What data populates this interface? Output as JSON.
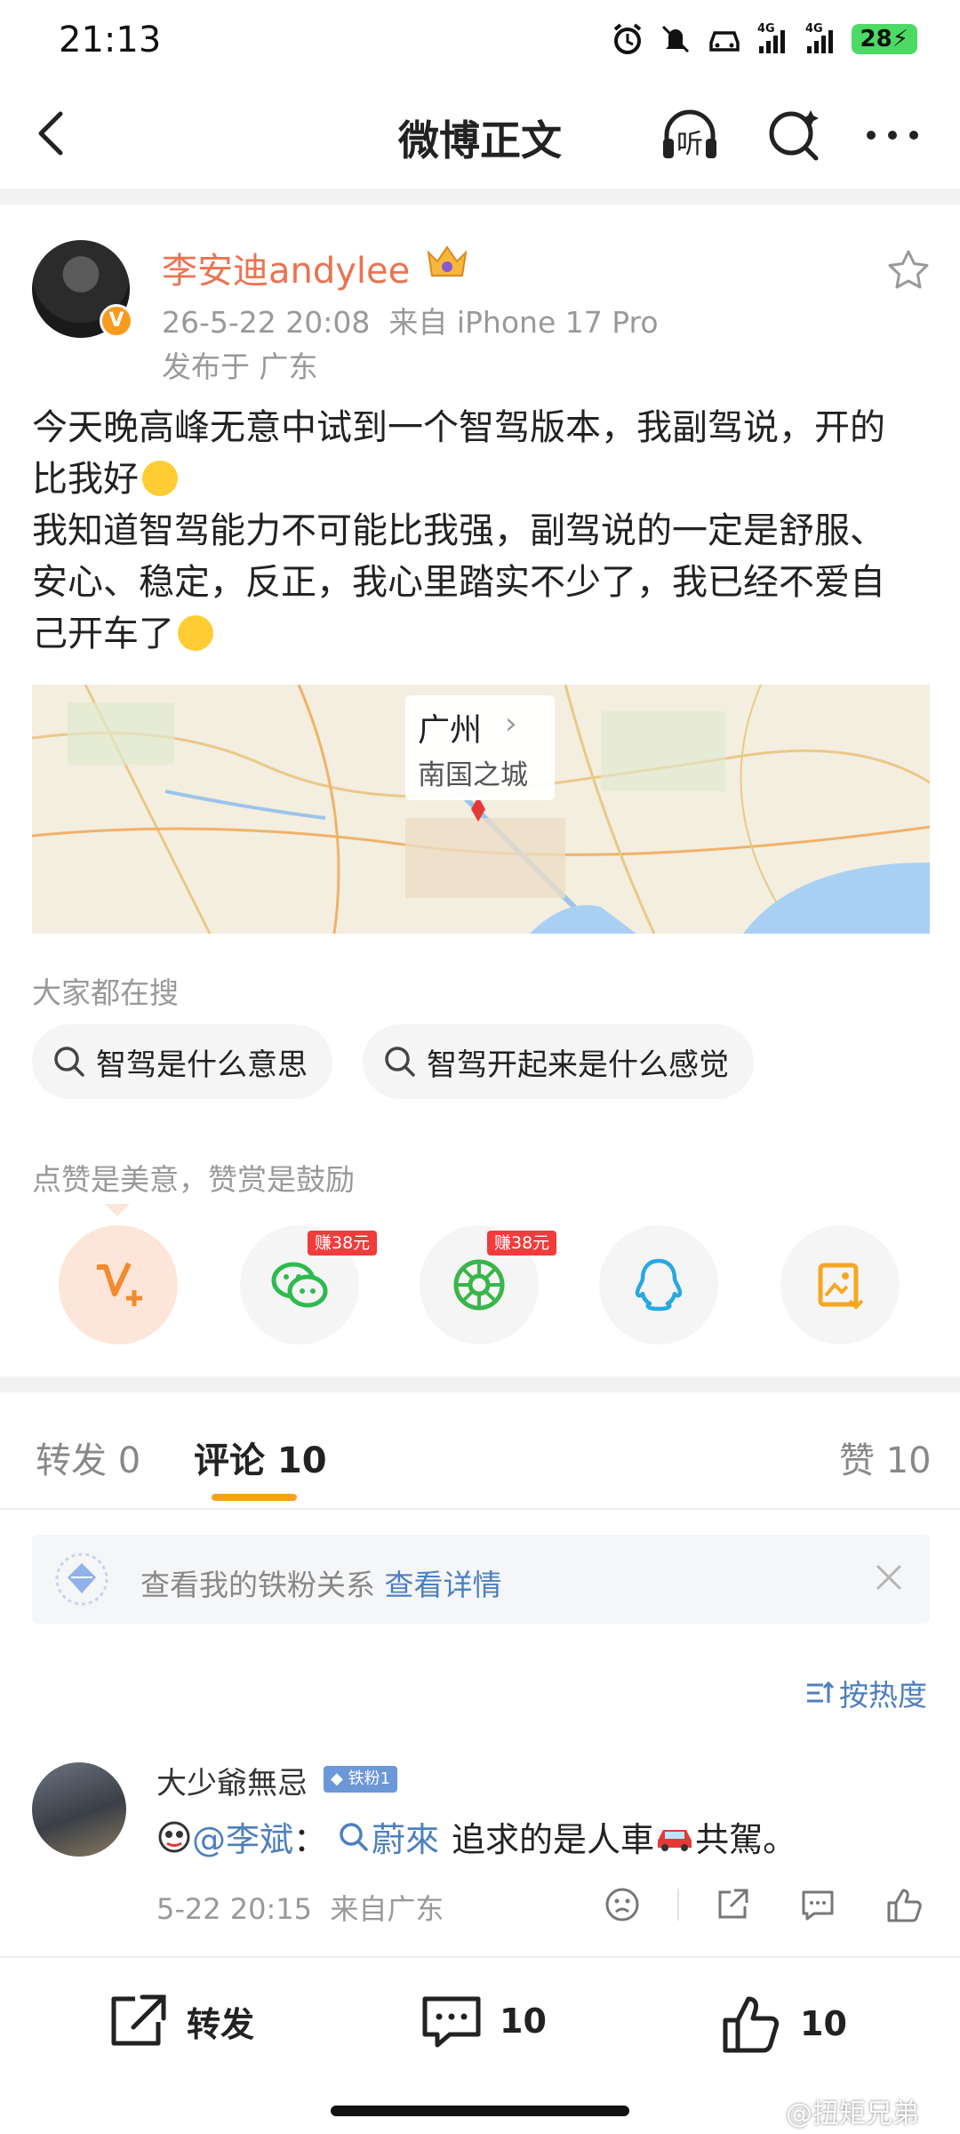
{
  "status_bar": {
    "time": "21:13",
    "network_1": "4G",
    "network_2": "4G",
    "battery": "28"
  },
  "header": {
    "title": "微博正文",
    "listen_label": "听"
  },
  "post": {
    "author": "李安迪andylee",
    "timestamp": "26-5-22 20:08",
    "source": "来自 iPhone 17 Pro",
    "location": "发布于 广东",
    "text_lines": [
      "今天晚高峰无意中试到一个智驾版本，我副驾说，开的",
      "比我好",
      "我知道智驾能力不可能比我强，副驾说的一定是舒服、",
      "安心、稳定，反正，我心里踏实不少了，我已经不爱自",
      "己开车了"
    ]
  },
  "map": {
    "city": "广州",
    "subtitle": "南国之城"
  },
  "searches": {
    "label": "大家都在搜",
    "items": [
      "智驾是什么意思",
      "智驾开起来是什么感觉"
    ]
  },
  "reward": {
    "label": "点赞是美意，赞赏是鼓励",
    "badge_text": "赚38元"
  },
  "tabs": {
    "repost": "转发 0",
    "comments": "评论 10",
    "likes": "赞 10"
  },
  "fan_banner": {
    "text": "查看我的铁粉关系",
    "link": "查看详情"
  },
  "sort": {
    "label": "按热度"
  },
  "comment": {
    "username": "大少爺無忌",
    "fan_tag": "铁粉1",
    "mention": "@李斌",
    "colon": "：",
    "topic": "蔚來",
    "text_before": "追求的是人車",
    "text_after": "共駕。",
    "time": "5-22 20:15",
    "source": "来自广东"
  },
  "bottom_bar": {
    "repost": "转发",
    "comments": "10",
    "likes": "10"
  },
  "watermark": "@扭矩兄弟",
  "colors": {
    "author_orange": "#eb7350",
    "link_blue": "#4e7fbe",
    "tab_accent": "#f7a21b"
  }
}
